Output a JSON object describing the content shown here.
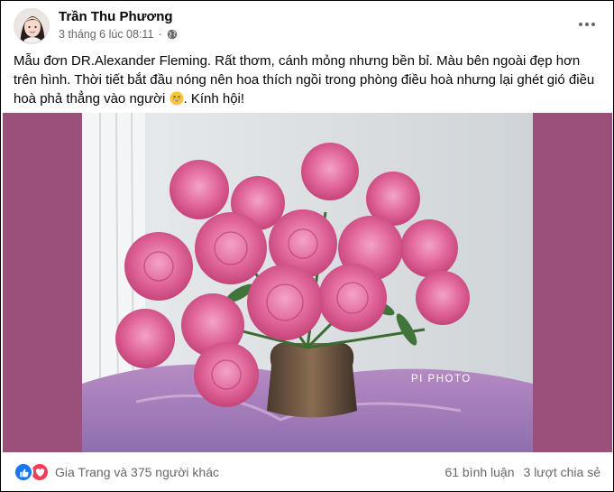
{
  "post": {
    "author": "Trần Thu Phương",
    "timestamp": "3 tháng 6 lúc 08:11",
    "separator": "·",
    "audience_icon": "globe-icon",
    "text": "Mẫu đơn DR.Alexander Fleming. Rất thơm, cánh mỏng nhưng bền bỉ. Màu bên ngoài đẹp hơn trên hình. Thời tiết bắt đầu nóng nên hoa thích ngồi trong phòng điều hoà nhưng lại ghét gió điều hoà phả thẳng vào người",
    "text_emoji": "grinning-face-emoji",
    "text_tail": ". Kính hội!",
    "photo": {
      "watermark": "PI PHOTO",
      "subject": "pink peonies in bronze vase",
      "side_color": "#9b4f7b"
    }
  },
  "reactions": {
    "icons": [
      "like-icon",
      "love-icon"
    ],
    "summary": "Gia Trang và 375 người khác",
    "comments": "61 bình luận",
    "shares": "3 lượt chia sẻ"
  },
  "colors": {
    "like": "#1877f2",
    "love": "#f33e58",
    "secondary_text": "#65676b"
  }
}
